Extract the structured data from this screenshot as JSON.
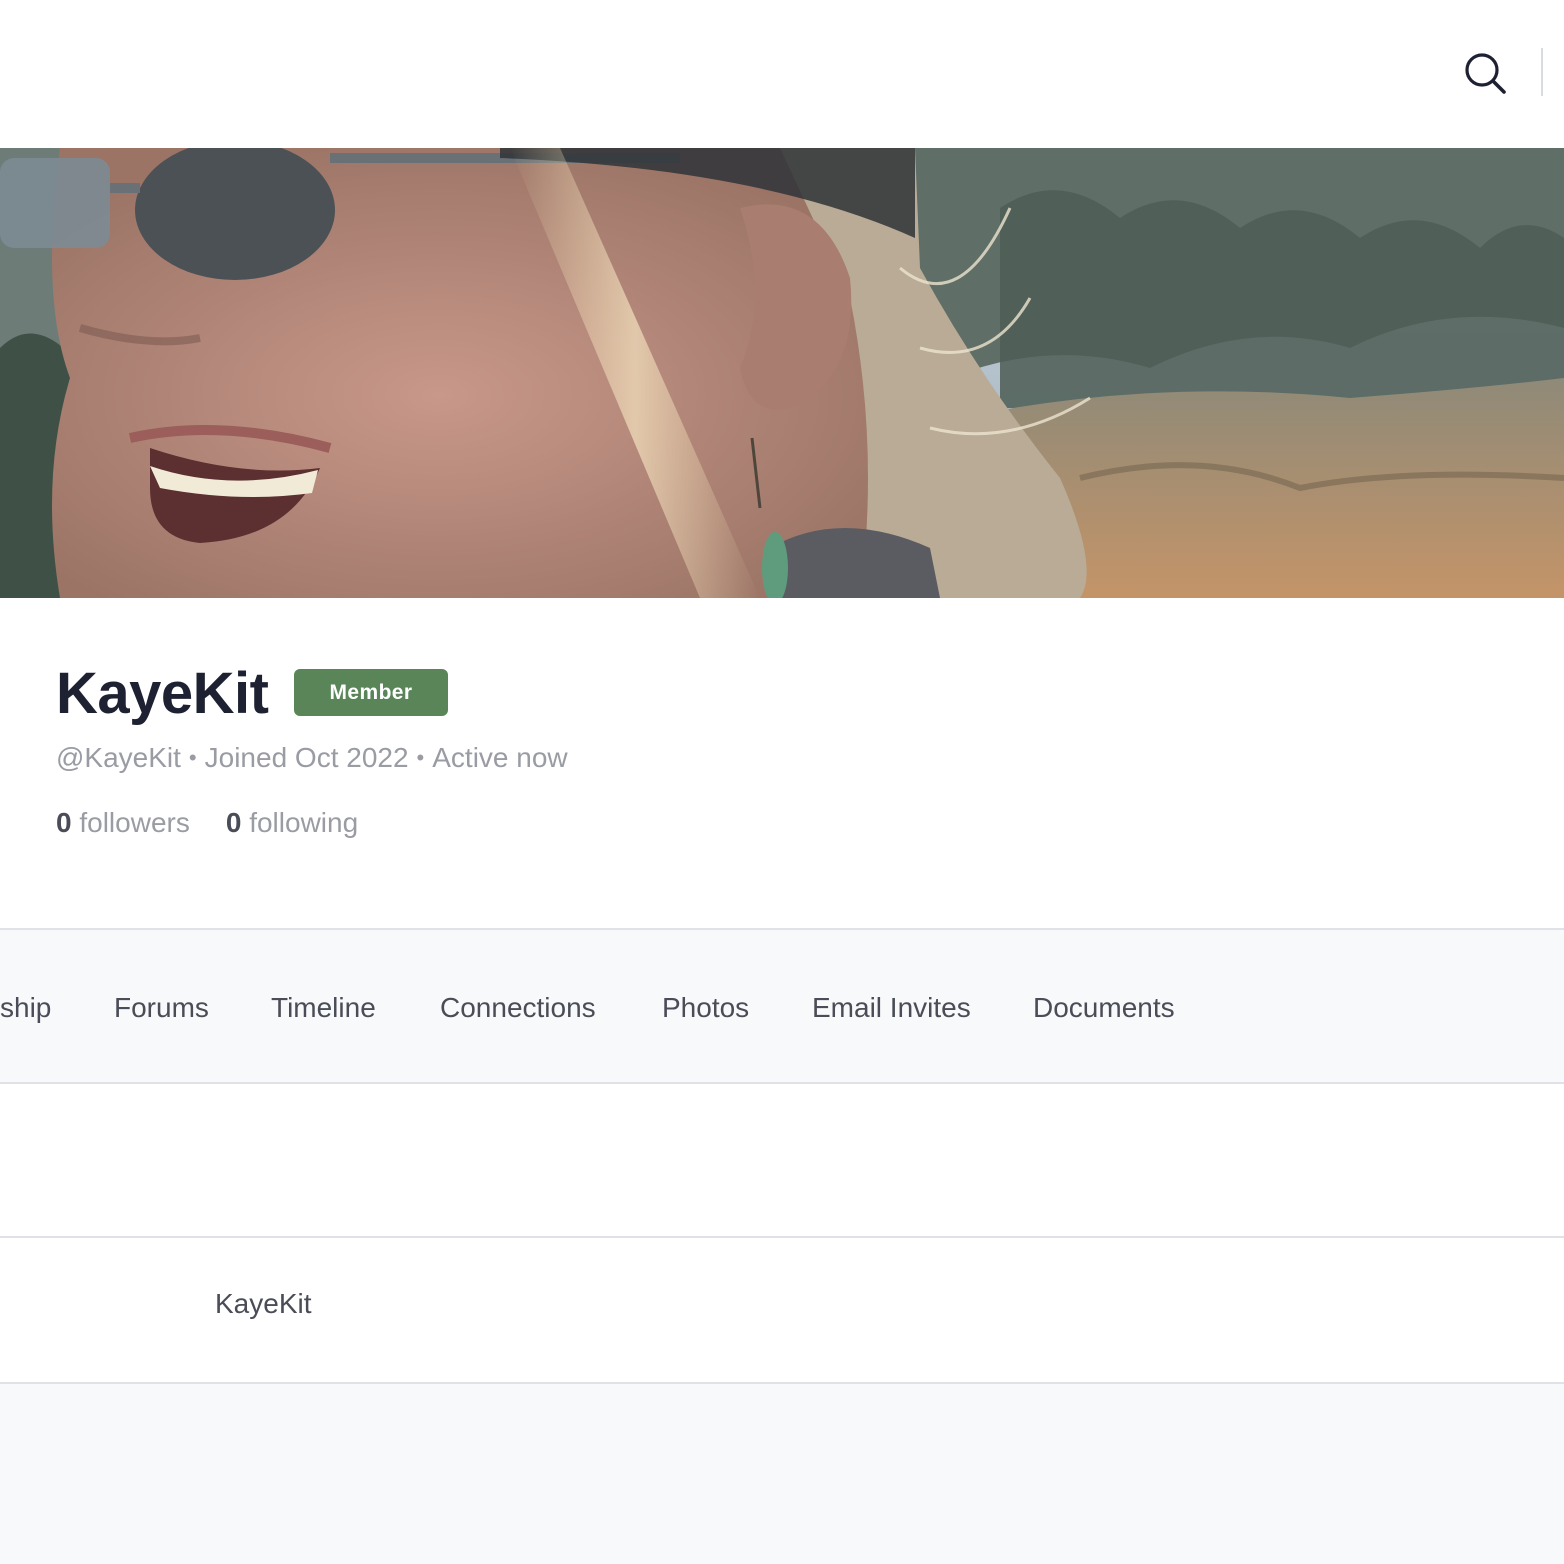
{
  "header": {
    "search_icon": "search-icon"
  },
  "cover": {
    "description_colors": {
      "sky": "#b9c6d1",
      "field": "#b58d66",
      "trees": "#5a6a5e"
    }
  },
  "profile": {
    "display_name": "KayeKit",
    "badge": "Member",
    "badge_color": "#5a8558",
    "handle": "@KayeKit",
    "joined": "Joined Oct 2022",
    "status": "Active now",
    "separator": "•",
    "followers_count": "0",
    "followers_label": "followers",
    "following_count": "0",
    "following_label": "following"
  },
  "tabs": [
    {
      "label": "ship"
    },
    {
      "label": "Forums"
    },
    {
      "label": "Timeline"
    },
    {
      "label": "Connections"
    },
    {
      "label": "Photos"
    },
    {
      "label": "Email Invites"
    },
    {
      "label": "Documents"
    }
  ],
  "details": {
    "name_value": "KayeKit"
  }
}
